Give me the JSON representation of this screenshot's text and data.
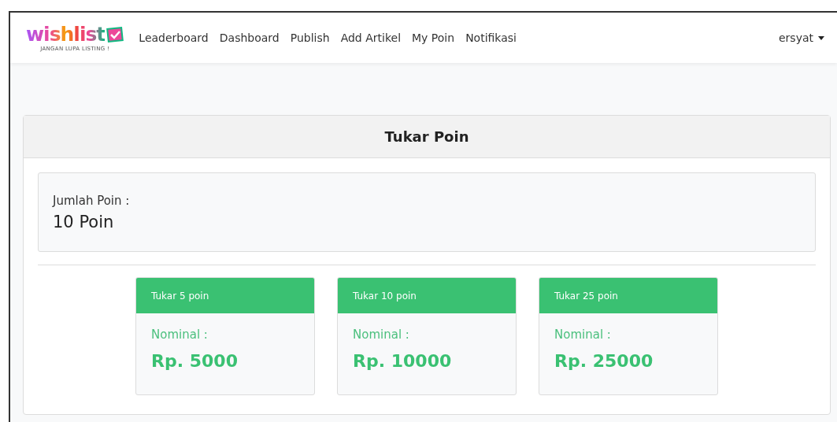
{
  "navbar": {
    "logo": {
      "text": "wishlist",
      "tagline": "JANGAN LUPA LISTING !"
    },
    "links": [
      {
        "label": "Leaderboard"
      },
      {
        "label": "Dashboard"
      },
      {
        "label": "Publish"
      },
      {
        "label": "Add Artikel"
      },
      {
        "label": "My Poin"
      },
      {
        "label": "Notifikasi"
      }
    ],
    "user": {
      "label": "ersyat"
    }
  },
  "card": {
    "title": "Tukar Poin",
    "balance": {
      "label": "Jumlah Poin :",
      "value": "10 Poin"
    },
    "options": [
      {
        "header": "Tukar 5 poin",
        "label": "Nominal :",
        "amount": "Rp. 5000"
      },
      {
        "header": "Tukar 10 poin",
        "label": "Nominal :",
        "amount": "Rp. 10000"
      },
      {
        "header": "Tukar 25 poin",
        "label": "Nominal :",
        "amount": "Rp. 25000"
      }
    ]
  }
}
